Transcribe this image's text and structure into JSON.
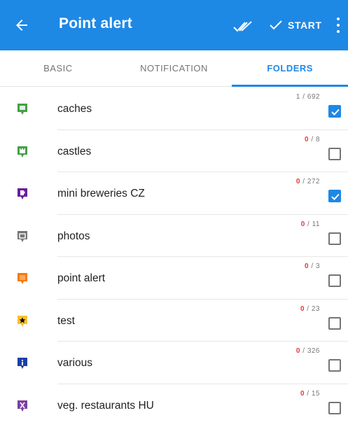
{
  "appbar": {
    "title": "Point alert",
    "start_label": "START",
    "color": "#1e88e5"
  },
  "tabs": [
    {
      "label": "BASIC",
      "active": false
    },
    {
      "label": "NOTIFICATION",
      "active": false
    },
    {
      "label": "FOLDERS",
      "active": true
    }
  ],
  "folders": [
    {
      "name": "caches",
      "selected": "1",
      "total": "692",
      "checked": true,
      "icon": "chat-icon",
      "color": "#43a047"
    },
    {
      "name": "castles",
      "selected": "0",
      "total": "8",
      "checked": false,
      "icon": "castle-icon",
      "color": "#43a047"
    },
    {
      "name": "mini breweries CZ",
      "selected": "0",
      "total": "272",
      "checked": true,
      "icon": "beer-icon",
      "color": "#6a1b9a"
    },
    {
      "name": "photos",
      "selected": "0",
      "total": "11",
      "checked": false,
      "icon": "photo-icon",
      "color": "#757575"
    },
    {
      "name": "point alert",
      "selected": "0",
      "total": "3",
      "checked": false,
      "icon": "alert-icon",
      "color": "#f57c00"
    },
    {
      "name": "test",
      "selected": "0",
      "total": "23",
      "checked": false,
      "icon": "star-icon",
      "color": "#fbc02d"
    },
    {
      "name": "various",
      "selected": "0",
      "total": "326",
      "checked": false,
      "icon": "info-icon",
      "color": "#1a3fa8"
    },
    {
      "name": "veg. restaurants HU",
      "selected": "0",
      "total": "15",
      "checked": false,
      "icon": "cutlery-icon",
      "color": "#7b3fa0"
    }
  ]
}
